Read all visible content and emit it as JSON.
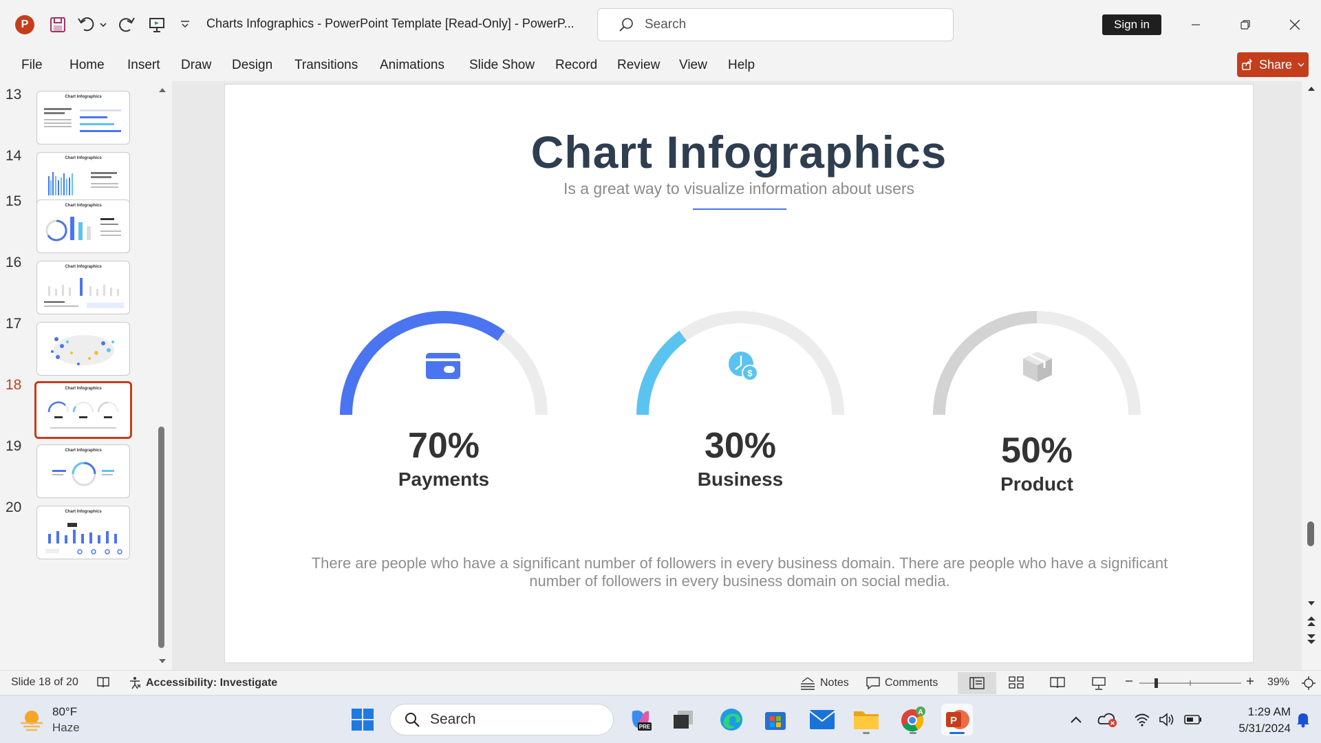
{
  "window": {
    "title": "Charts Infographics - PowerPoint Template [Read-Only]  -  PowerP...",
    "search_placeholder": "Search",
    "signin_label": "Sign in"
  },
  "ribbon": {
    "tabs": [
      "File",
      "Home",
      "Insert",
      "Draw",
      "Design",
      "Transitions",
      "Animations",
      "Slide Show",
      "Record",
      "Review",
      "View",
      "Help"
    ],
    "share_label": "Share"
  },
  "thumbnails": {
    "items": [
      {
        "number": "13",
        "title": "Chart Infographics"
      },
      {
        "number": "14",
        "title": "Chart Infographics"
      },
      {
        "number": "15",
        "title": "Chart Infographics"
      },
      {
        "number": "16",
        "title": "Chart Infographics"
      },
      {
        "number": "17",
        "title": ""
      },
      {
        "number": "18",
        "title": "Chart Infographics"
      },
      {
        "number": "19",
        "title": "Chart Infographics"
      },
      {
        "number": "20",
        "title": "Chart Infographics"
      }
    ],
    "active_index": 5
  },
  "slide": {
    "title": "Chart Infographics",
    "subtitle": "Is a great way to visualize information about users",
    "body": "There are people who have a significant number of followers in every business domain. There are people who have a significant number of followers in every business domain on social media.",
    "gauges": [
      {
        "percent_label": "70%",
        "label": "Payments",
        "value": 0.7,
        "color": "#4a74f0",
        "icon": "credit-card-icon"
      },
      {
        "percent_label": "30%",
        "label": "Business",
        "value": 0.3,
        "color": "#5bc3f0",
        "icon": "business-dollar-icon"
      },
      {
        "percent_label": "50%",
        "label": "Product",
        "value": 0.5,
        "color": "#d3d3d3",
        "icon": "box-icon"
      }
    ],
    "track_color": "#ececec"
  },
  "statusbar": {
    "slide_info": "Slide 18 of 20",
    "accessibility": "Accessibility: Investigate",
    "notes": "Notes",
    "comments": "Comments",
    "zoom": "39%"
  },
  "taskbar": {
    "weather_temp": "80°F",
    "weather_cond": "Haze",
    "search_placeholder": "Search",
    "time": "1:29 AM",
    "date": "5/31/2024"
  }
}
